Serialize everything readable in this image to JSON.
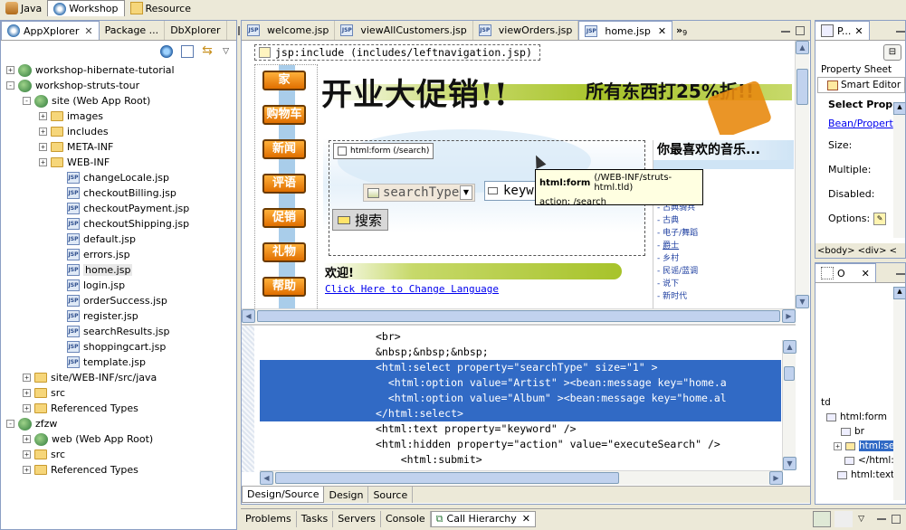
{
  "perspectives": {
    "tabs": [
      {
        "label": "Java"
      },
      {
        "label": "Workshop"
      },
      {
        "label": "Resource"
      }
    ]
  },
  "left_view": {
    "tabs": [
      {
        "label": "AppXplorer"
      },
      {
        "label": "Package ..."
      },
      {
        "label": "DbXplorer"
      }
    ],
    "tree": [
      {
        "label": "workshop-hibernate-tutorial",
        "level": 0,
        "kind": "project",
        "exp": "+"
      },
      {
        "label": "workshop-struts-tour",
        "level": 0,
        "kind": "project",
        "exp": "-"
      },
      {
        "label": "site (Web App Root)",
        "level": 1,
        "kind": "web",
        "exp": "-"
      },
      {
        "label": "images",
        "level": 2,
        "kind": "folder",
        "exp": "+"
      },
      {
        "label": "includes",
        "level": 2,
        "kind": "folder",
        "exp": "+"
      },
      {
        "label": "META-INF",
        "level": 2,
        "kind": "folder",
        "exp": "+"
      },
      {
        "label": "WEB-INF",
        "level": 2,
        "kind": "folder",
        "exp": "+"
      },
      {
        "label": "changeLocale.jsp",
        "level": 3,
        "kind": "jsp"
      },
      {
        "label": "checkoutBilling.jsp",
        "level": 3,
        "kind": "jsp"
      },
      {
        "label": "checkoutPayment.jsp",
        "level": 3,
        "kind": "jsp"
      },
      {
        "label": "checkoutShipping.jsp",
        "level": 3,
        "kind": "jsp"
      },
      {
        "label": "default.jsp",
        "level": 3,
        "kind": "jsp"
      },
      {
        "label": "errors.jsp",
        "level": 3,
        "kind": "jsp"
      },
      {
        "label": "home.jsp",
        "level": 3,
        "kind": "jsp",
        "selected": true
      },
      {
        "label": "login.jsp",
        "level": 3,
        "kind": "jsp"
      },
      {
        "label": "orderSuccess.jsp",
        "level": 3,
        "kind": "jsp"
      },
      {
        "label": "register.jsp",
        "level": 3,
        "kind": "jsp"
      },
      {
        "label": "searchResults.jsp",
        "level": 3,
        "kind": "jsp"
      },
      {
        "label": "shoppingcart.jsp",
        "level": 3,
        "kind": "jsp"
      },
      {
        "label": "template.jsp",
        "level": 3,
        "kind": "jsp"
      },
      {
        "label": "site/WEB-INF/src/java",
        "level": 1,
        "kind": "folder",
        "exp": "+"
      },
      {
        "label": "src",
        "level": 1,
        "kind": "folder",
        "exp": "+"
      },
      {
        "label": "Referenced Types",
        "level": 1,
        "kind": "folder",
        "exp": "+"
      },
      {
        "label": "zfzw",
        "level": 0,
        "kind": "project",
        "exp": "-"
      },
      {
        "label": "web (Web App Root)",
        "level": 1,
        "kind": "web",
        "exp": "+"
      },
      {
        "label": "src",
        "level": 1,
        "kind": "folder",
        "exp": "+"
      },
      {
        "label": "Referenced Types",
        "level": 1,
        "kind": "folder",
        "exp": "+"
      }
    ]
  },
  "editor": {
    "tabs": [
      {
        "label": "welcome.jsp"
      },
      {
        "label": "viewAllCustomers.jsp"
      },
      {
        "label": "viewOrders.jsp"
      },
      {
        "label": "home.jsp",
        "active": true
      }
    ],
    "overflow": "»",
    "overflow_count": "9",
    "include_label": "jsp:include (includes/leftnavigation.jsp)",
    "nav_buttons": [
      "家",
      "购物车",
      "新闻",
      "评语",
      "促销",
      "礼物",
      "帮助"
    ],
    "banner_text": "开业大促销!!",
    "banner_sale": "所有东西打25%折!!",
    "form_label": "html:form (/search)",
    "search_select": "searchType",
    "keyword_text": "keyw",
    "search_button": "搜索",
    "welcome": "欢迎!",
    "change_lang": "Click Here to Change Language",
    "music_title": "你最喜欢的音乐...",
    "music_items": [
      "古典骑兵",
      "古典",
      "电子/舞蹈",
      "爵士",
      "乡村",
      "民谣/蓝调",
      "说下",
      "新时代"
    ],
    "tooltip": {
      "title": "html:form",
      "path": "(/WEB-INF/struts-html.tld)",
      "action": "action: /search"
    },
    "code_lines": [
      {
        "text": "<br>",
        "hl": false
      },
      {
        "text": "&nbsp;&nbsp;&nbsp;",
        "hl": false
      },
      {
        "text": "<html:select property=\"searchType\" size=\"1\" >",
        "hl": true
      },
      {
        "text": "  <html:option value=\"Artist\" ><bean:message key=\"home.a",
        "hl": true
      },
      {
        "text": "  <html:option value=\"Album\" ><bean:message key=\"home.al",
        "hl": true
      },
      {
        "text": "</html:select>",
        "hl": true
      },
      {
        "text": "<html:text property=\"keyword\" />",
        "hl": false
      },
      {
        "text": "<html:hidden property=\"action\" value=\"executeSearch\" />",
        "hl": false
      },
      {
        "text": "    <html:submit>",
        "hl": false
      }
    ],
    "bottom_tabs": [
      {
        "label": "Design/Source",
        "active": true
      },
      {
        "label": "Design"
      },
      {
        "label": "Source"
      }
    ]
  },
  "properties": {
    "tab_label": "P...",
    "property_sheet": "Property Sheet",
    "smart_editor": "Smart Editor",
    "select_prop": "Select Prop",
    "bean_link": "Bean/Propert",
    "size_label": "Size:",
    "multiple_label": "Multiple:",
    "disabled_label": "Disabled:",
    "options_label": "Options:",
    "breadcrumb": "<body> <div> <"
  },
  "outline": {
    "tab_label": "O",
    "items": [
      {
        "label": "td"
      },
      {
        "label": "html:form"
      },
      {
        "label": "br"
      },
      {
        "label": "html:sele",
        "selected": true
      },
      {
        "label": "</html:sele"
      },
      {
        "label": "html:text"
      }
    ]
  },
  "bottom": {
    "tabs": [
      {
        "label": "Problems"
      },
      {
        "label": "Tasks"
      },
      {
        "label": "Servers"
      },
      {
        "label": "Console"
      },
      {
        "label": "Call Hierarchy",
        "active": true
      }
    ]
  }
}
